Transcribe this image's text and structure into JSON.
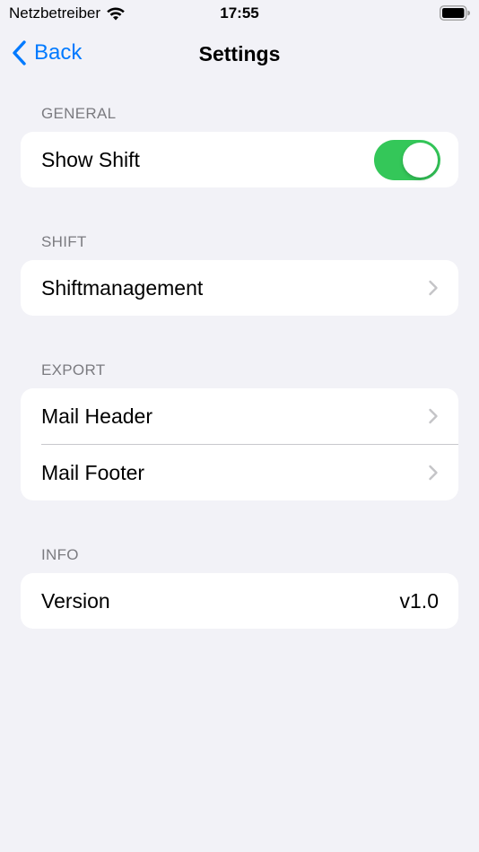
{
  "status_bar": {
    "carrier": "Netzbetreiber",
    "time": "17:55",
    "wifi_icon": "wifi-icon",
    "battery_icon": "battery-icon"
  },
  "nav": {
    "back_label": "Back",
    "title": "Settings",
    "accent_color": "#007aff"
  },
  "sections": {
    "general": {
      "header": "GENERAL",
      "show_shift": {
        "label": "Show Shift",
        "toggle_on": true,
        "toggle_color": "#34c759"
      }
    },
    "shift": {
      "header": "SHIFT",
      "shiftmanagement": {
        "label": "Shiftmanagement",
        "icon": "chevron-right-icon"
      }
    },
    "export": {
      "header": "EXPORT",
      "mail_header": {
        "label": "Mail Header",
        "icon": "chevron-right-icon"
      },
      "mail_footer": {
        "label": "Mail Footer",
        "icon": "chevron-right-icon"
      }
    },
    "info": {
      "header": "INFO",
      "version": {
        "label": "Version",
        "value": "v1.0"
      }
    }
  }
}
